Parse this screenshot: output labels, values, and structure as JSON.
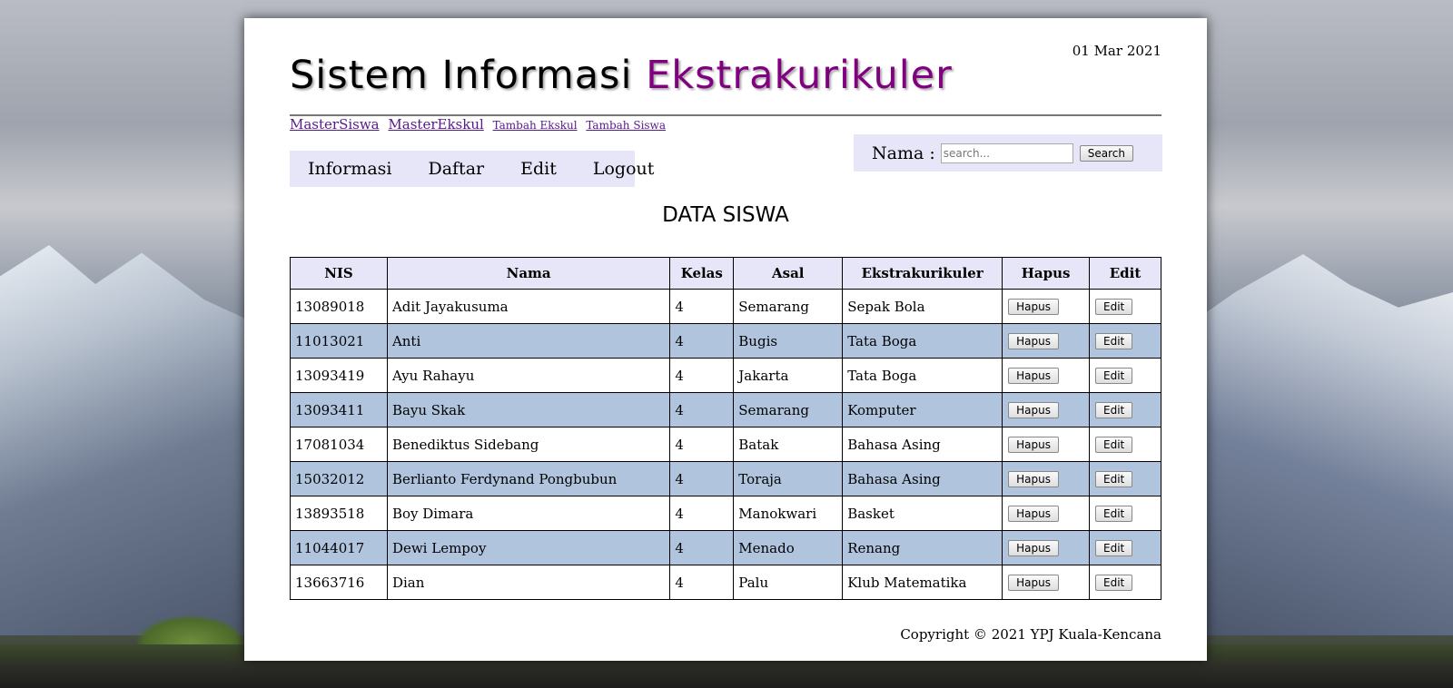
{
  "header": {
    "date": "01 Mar 2021",
    "title_main": "Sistem Informasi ",
    "title_accent": "Ekstrakurikuler"
  },
  "top_links": [
    {
      "label": "MasterSiswa"
    },
    {
      "label": "MasterEkskul"
    },
    {
      "label": "Tambah Ekskul"
    },
    {
      "label": "Tambah Siswa"
    }
  ],
  "nav": [
    {
      "label": "Informasi"
    },
    {
      "label": "Daftar"
    },
    {
      "label": "Edit"
    },
    {
      "label": "Logout"
    }
  ],
  "search": {
    "label": "Nama :",
    "placeholder": "search...",
    "button": "Search"
  },
  "page_heading": "DATA SISWA",
  "table": {
    "columns": [
      "NIS",
      "Nama",
      "Kelas",
      "Asal",
      "Ekstrakurikuler",
      "Hapus",
      "Edit"
    ],
    "delete_label": "Hapus",
    "edit_label": "Edit",
    "rows": [
      {
        "nis": "13089018",
        "nama": "Adit Jayakusuma",
        "kelas": "4",
        "asal": "Semarang",
        "ekskul": "Sepak Bola"
      },
      {
        "nis": "11013021",
        "nama": "Anti",
        "kelas": "4",
        "asal": "Bugis",
        "ekskul": "Tata Boga"
      },
      {
        "nis": "13093419",
        "nama": "Ayu Rahayu",
        "kelas": "4",
        "asal": "Jakarta",
        "ekskul": "Tata Boga"
      },
      {
        "nis": "13093411",
        "nama": "Bayu Skak",
        "kelas": "4",
        "asal": "Semarang",
        "ekskul": "Komputer"
      },
      {
        "nis": "17081034",
        "nama": "Benediktus Sidebang",
        "kelas": "4",
        "asal": "Batak",
        "ekskul": "Bahasa Asing"
      },
      {
        "nis": "15032012",
        "nama": "Berlianto Ferdynand Pongbubun",
        "kelas": "4",
        "asal": "Toraja",
        "ekskul": "Bahasa Asing"
      },
      {
        "nis": "13893518",
        "nama": "Boy Dimara",
        "kelas": "4",
        "asal": "Manokwari",
        "ekskul": "Basket"
      },
      {
        "nis": "11044017",
        "nama": "Dewi Lempoy",
        "kelas": "4",
        "asal": "Menado",
        "ekskul": "Renang"
      },
      {
        "nis": "13663716",
        "nama": "Dian",
        "kelas": "4",
        "asal": "Palu",
        "ekskul": "Klub Matematika"
      }
    ]
  },
  "footer": "Copyright © 2021 YPJ Kuala-Kencana",
  "colors": {
    "accent": "#800080",
    "header_bg": "#e6e6f8",
    "alt_row": "#b0c4de"
  }
}
